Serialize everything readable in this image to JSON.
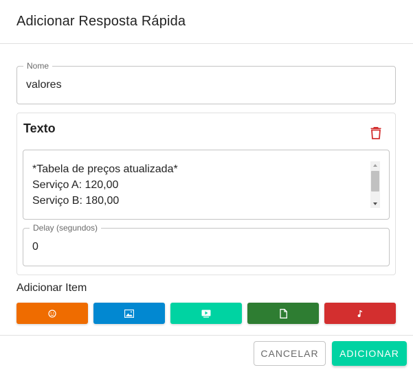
{
  "dialog": {
    "title": "Adicionar Resposta Rápida"
  },
  "name_field": {
    "label": "Nome",
    "value": "valores"
  },
  "text_block": {
    "title": "Texto",
    "delete_icon": "trash-icon",
    "content": "*Tabela de preços atualizada*\nServiço A: 120,00\nServiço B: 180,00",
    "delay_label": "Delay (segundos)",
    "delay_value": "0"
  },
  "add_item": {
    "label": "Adicionar Item",
    "buttons": [
      {
        "icon": "emoji-icon",
        "color": "#ef6c00"
      },
      {
        "icon": "image-icon",
        "color": "#0288d1"
      },
      {
        "icon": "video-icon",
        "color": "#00d3a2"
      },
      {
        "icon": "document-icon",
        "color": "#2e7d32"
      },
      {
        "icon": "music-icon",
        "color": "#d32f2f"
      }
    ]
  },
  "actions": {
    "cancel_label": "CANCELAR",
    "add_label": "ADICIONAR"
  },
  "colors": {
    "accent": "#00d3a2",
    "danger": "#d32f2f"
  }
}
